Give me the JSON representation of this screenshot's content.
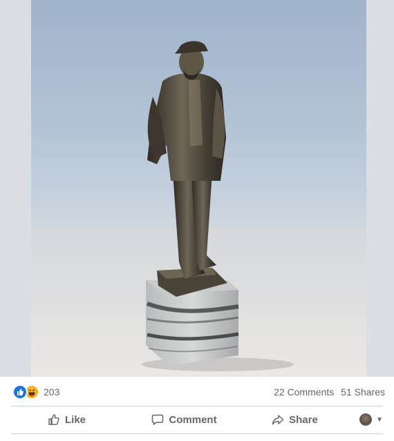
{
  "post": {
    "photo": {
      "subject": "bronze statuette on marble base"
    },
    "reactions": {
      "count": "203",
      "types": [
        "like-icon",
        "haha-icon"
      ]
    },
    "comments_label": "22 Comments",
    "shares_label": "51 Shares",
    "actions": {
      "like_label": "Like",
      "comment_label": "Comment",
      "share_label": "Share"
    }
  },
  "colors": {
    "like_blue": "#1b74e4",
    "haha_yellow": "#f7b125",
    "text_secondary": "#65676b",
    "divider": "#ced0d4"
  }
}
